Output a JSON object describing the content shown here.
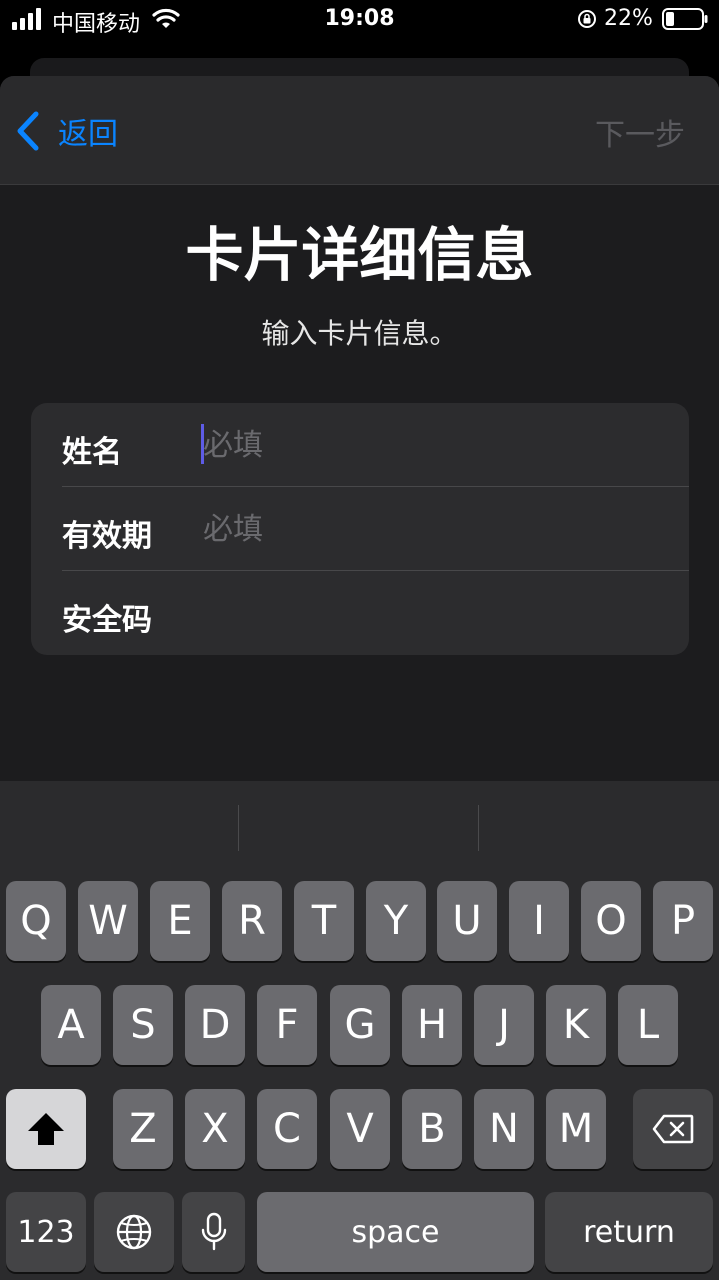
{
  "status_bar": {
    "carrier": "中国移动",
    "time": "19:08",
    "battery_percent": "22%"
  },
  "nav": {
    "back_label": "返回",
    "next_label": "下一步"
  },
  "header": {
    "title": "卡片详细信息",
    "subtitle": "输入卡片信息。"
  },
  "form": {
    "rows": [
      {
        "label": "姓名",
        "placeholder": "必填",
        "value": ""
      },
      {
        "label": "有效期",
        "placeholder": "必填",
        "value": ""
      },
      {
        "label": "安全码",
        "placeholder": "",
        "value": ""
      }
    ]
  },
  "keyboard": {
    "row1": [
      "Q",
      "W",
      "E",
      "R",
      "T",
      "Y",
      "U",
      "I",
      "O",
      "P"
    ],
    "row2": [
      "A",
      "S",
      "D",
      "F",
      "G",
      "H",
      "J",
      "K",
      "L"
    ],
    "row3": [
      "Z",
      "X",
      "C",
      "V",
      "B",
      "N",
      "M"
    ],
    "numbers_label": "123",
    "space_label": "space",
    "return_label": "return"
  },
  "colors": {
    "accent": "#0a84ff",
    "sheet_bg": "#1c1c1e",
    "field_bg": "#2c2c2e",
    "key_bg": "#6b6b6f"
  }
}
